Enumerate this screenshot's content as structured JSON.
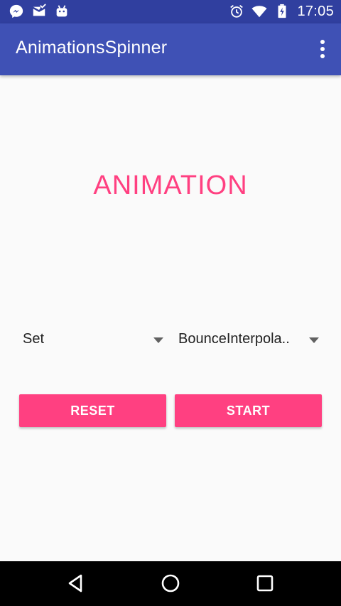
{
  "status_bar": {
    "time": "17:05",
    "left_icons": [
      "messenger-icon",
      "mail-icon",
      "android-icon"
    ],
    "right_icons": [
      "alarm-icon",
      "wifi-icon",
      "battery-charging-icon"
    ]
  },
  "app_bar": {
    "title": "AnimationsSpinner",
    "overflow_icon": "more-vert-icon"
  },
  "content": {
    "animation_text": "ANIMATION",
    "spinner_left": {
      "selected": "Set"
    },
    "spinner_right": {
      "selected": "BounceInterpola.."
    },
    "reset_label": "RESET",
    "start_label": "START"
  },
  "nav_bar": {
    "icons": [
      "back-icon",
      "home-icon",
      "recents-icon"
    ]
  },
  "colors": {
    "status_bar": "#303f9f",
    "app_bar": "#3f51b5",
    "accent": "#ff4081",
    "background": "#fafafa"
  }
}
